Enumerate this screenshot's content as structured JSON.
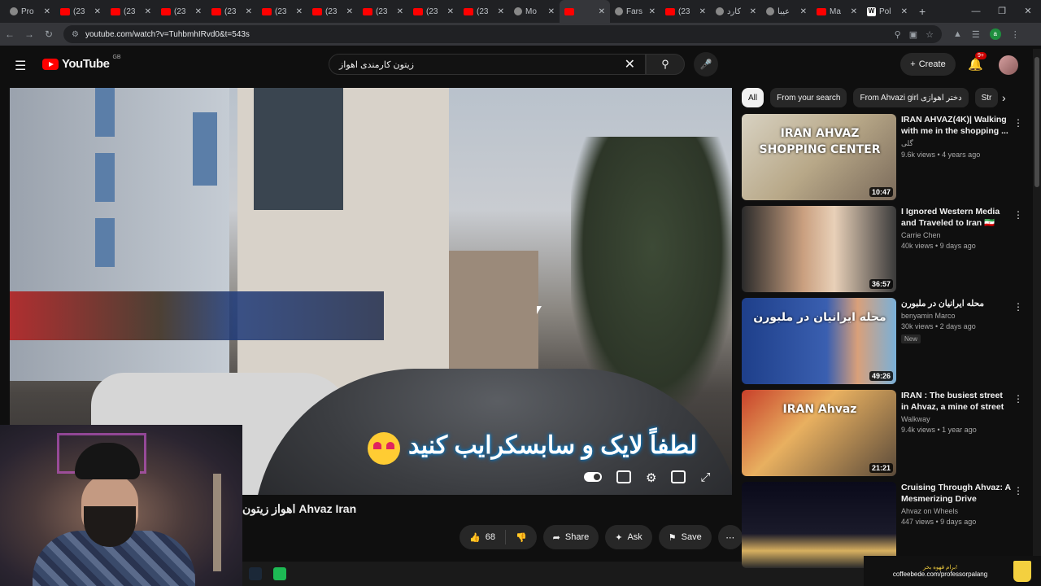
{
  "browser": {
    "tabs": [
      {
        "title": "Pro",
        "icon": "generic"
      },
      {
        "title": "(23",
        "icon": "youtube"
      },
      {
        "title": "(23",
        "icon": "youtube"
      },
      {
        "title": "(23",
        "icon": "youtube"
      },
      {
        "title": "(23",
        "icon": "youtube"
      },
      {
        "title": "(23",
        "icon": "youtube"
      },
      {
        "title": "(23",
        "icon": "youtube"
      },
      {
        "title": "(23",
        "icon": "youtube"
      },
      {
        "title": "(23",
        "icon": "youtube"
      },
      {
        "title": "(23",
        "icon": "youtube"
      },
      {
        "title": "Mo",
        "icon": "generic"
      },
      {
        "title": "",
        "icon": "youtube",
        "active": true
      },
      {
        "title": "Fars",
        "icon": "generic"
      },
      {
        "title": "(23",
        "icon": "youtube"
      },
      {
        "title": "کارد",
        "icon": "generic"
      },
      {
        "title": "عیبا",
        "icon": "generic"
      },
      {
        "title": "Ma",
        "icon": "gmail"
      },
      {
        "title": "Pol",
        "icon": "wikipedia"
      }
    ],
    "url": "youtube.com/watch?v=TuhbmhIRvd0&t=543s"
  },
  "youtube": {
    "logo_text": "YouTube",
    "region": "GB",
    "search_query": "زیتون کارمندی اهواز",
    "create_label": "Create",
    "notifications_badge": "9+"
  },
  "video": {
    "overlay_text": "لطفاً لایک و سابسکرایب کنید",
    "title": "اهواز زیتون Ahvaz Iran",
    "likes": "68",
    "share_label": "Share",
    "ask_label": "Ask",
    "save_label": "Save"
  },
  "chips": [
    "All",
    "From your search",
    "From Ahvazi girl دختر اهوازی",
    "Str"
  ],
  "recommendations": [
    {
      "title": "IRAN AHVAZ(4K)| Walking with me in the shopping ...",
      "channel": "گلی",
      "views": "9.6k views • 4 years ago",
      "duration": "10:47",
      "thumb_text": "IRAN AHVAZ SHOPPING CENTER"
    },
    {
      "title": "I Ignored Western Media and Traveled to Iran 🇮🇷 Here's ...",
      "channel": "Carrie Chen",
      "views": "40k views • 9 days ago",
      "duration": "36:57",
      "thumb_text": ""
    },
    {
      "title": "محله ایرانیان در ملبورن",
      "channel": "benyamin Marco",
      "views": "30k views • 2 days ago",
      "duration": "49:26",
      "badge": "New",
      "thumb_text": "محله ایرانیان در ملبورن"
    },
    {
      "title": "IRAN : The busiest street in Ahvaz, a mine of street foo...",
      "channel": "Walkway",
      "views": "9.4k views • 1 year ago",
      "duration": "21:21",
      "thumb_text": "IRAN Ahvaz"
    },
    {
      "title": "Cruising Through Ahvaz: A Mesmerizing Drive Throug...",
      "channel": "Ahvaz on Wheels",
      "views": "447 views • 9 days ago",
      "duration": "",
      "thumb_text": ""
    }
  ],
  "coffee": {
    "top": "برام قهوه بخر!",
    "url": "coffeebede.com/professorpalang"
  },
  "colors": {
    "bg": "#0f0f0f",
    "accent": "#ff0000",
    "chip_active": "#f1f1f1"
  }
}
